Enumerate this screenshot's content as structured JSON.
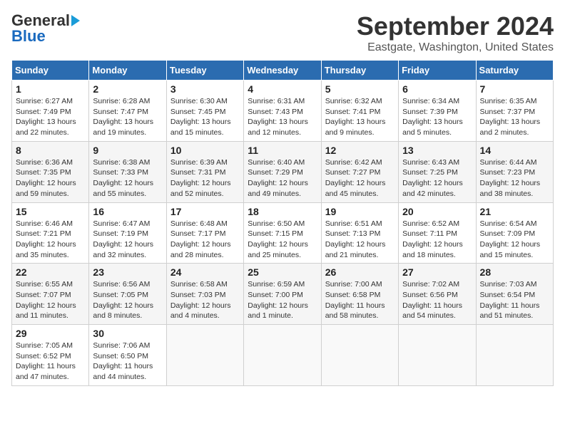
{
  "header": {
    "logo_general": "General",
    "logo_blue": "Blue",
    "title": "September 2024",
    "subtitle": "Eastgate, Washington, United States"
  },
  "calendar": {
    "columns": [
      "Sunday",
      "Monday",
      "Tuesday",
      "Wednesday",
      "Thursday",
      "Friday",
      "Saturday"
    ],
    "weeks": [
      [
        null,
        {
          "day": "2",
          "sunrise": "6:28 AM",
          "sunset": "7:47 PM",
          "daylight": "13 hours and 19 minutes."
        },
        {
          "day": "3",
          "sunrise": "6:30 AM",
          "sunset": "7:45 PM",
          "daylight": "13 hours and 15 minutes."
        },
        {
          "day": "4",
          "sunrise": "6:31 AM",
          "sunset": "7:43 PM",
          "daylight": "13 hours and 12 minutes."
        },
        {
          "day": "5",
          "sunrise": "6:32 AM",
          "sunset": "7:41 PM",
          "daylight": "13 hours and 9 minutes."
        },
        {
          "day": "6",
          "sunrise": "6:34 AM",
          "sunset": "7:39 PM",
          "daylight": "13 hours and 5 minutes."
        },
        {
          "day": "7",
          "sunrise": "6:35 AM",
          "sunset": "7:37 PM",
          "daylight": "13 hours and 2 minutes."
        }
      ],
      [
        {
          "day": "1",
          "sunrise": "6:27 AM",
          "sunset": "7:49 PM",
          "daylight": "13 hours and 22 minutes."
        },
        {
          "day": "9",
          "sunrise": "6:38 AM",
          "sunset": "7:33 PM",
          "daylight": "12 hours and 55 minutes."
        },
        {
          "day": "10",
          "sunrise": "6:39 AM",
          "sunset": "7:31 PM",
          "daylight": "12 hours and 52 minutes."
        },
        {
          "day": "11",
          "sunrise": "6:40 AM",
          "sunset": "7:29 PM",
          "daylight": "12 hours and 49 minutes."
        },
        {
          "day": "12",
          "sunrise": "6:42 AM",
          "sunset": "7:27 PM",
          "daylight": "12 hours and 45 minutes."
        },
        {
          "day": "13",
          "sunrise": "6:43 AM",
          "sunset": "7:25 PM",
          "daylight": "12 hours and 42 minutes."
        },
        {
          "day": "14",
          "sunrise": "6:44 AM",
          "sunset": "7:23 PM",
          "daylight": "12 hours and 38 minutes."
        }
      ],
      [
        {
          "day": "8",
          "sunrise": "6:36 AM",
          "sunset": "7:35 PM",
          "daylight": "12 hours and 59 minutes."
        },
        {
          "day": "16",
          "sunrise": "6:47 AM",
          "sunset": "7:19 PM",
          "daylight": "12 hours and 32 minutes."
        },
        {
          "day": "17",
          "sunrise": "6:48 AM",
          "sunset": "7:17 PM",
          "daylight": "12 hours and 28 minutes."
        },
        {
          "day": "18",
          "sunrise": "6:50 AM",
          "sunset": "7:15 PM",
          "daylight": "12 hours and 25 minutes."
        },
        {
          "day": "19",
          "sunrise": "6:51 AM",
          "sunset": "7:13 PM",
          "daylight": "12 hours and 21 minutes."
        },
        {
          "day": "20",
          "sunrise": "6:52 AM",
          "sunset": "7:11 PM",
          "daylight": "12 hours and 18 minutes."
        },
        {
          "day": "21",
          "sunrise": "6:54 AM",
          "sunset": "7:09 PM",
          "daylight": "12 hours and 15 minutes."
        }
      ],
      [
        {
          "day": "15",
          "sunrise": "6:46 AM",
          "sunset": "7:21 PM",
          "daylight": "12 hours and 35 minutes."
        },
        {
          "day": "23",
          "sunrise": "6:56 AM",
          "sunset": "7:05 PM",
          "daylight": "12 hours and 8 minutes."
        },
        {
          "day": "24",
          "sunrise": "6:58 AM",
          "sunset": "7:03 PM",
          "daylight": "12 hours and 4 minutes."
        },
        {
          "day": "25",
          "sunrise": "6:59 AM",
          "sunset": "7:00 PM",
          "daylight": "12 hours and 1 minute."
        },
        {
          "day": "26",
          "sunrise": "7:00 AM",
          "sunset": "6:58 PM",
          "daylight": "11 hours and 58 minutes."
        },
        {
          "day": "27",
          "sunrise": "7:02 AM",
          "sunset": "6:56 PM",
          "daylight": "11 hours and 54 minutes."
        },
        {
          "day": "28",
          "sunrise": "7:03 AM",
          "sunset": "6:54 PM",
          "daylight": "11 hours and 51 minutes."
        }
      ],
      [
        {
          "day": "22",
          "sunrise": "6:55 AM",
          "sunset": "7:07 PM",
          "daylight": "12 hours and 11 minutes."
        },
        {
          "day": "30",
          "sunrise": "7:06 AM",
          "sunset": "6:50 PM",
          "daylight": "11 hours and 44 minutes."
        },
        null,
        null,
        null,
        null,
        null
      ],
      [
        {
          "day": "29",
          "sunrise": "7:05 AM",
          "sunset": "6:52 PM",
          "daylight": "11 hours and 47 minutes."
        },
        null,
        null,
        null,
        null,
        null,
        null
      ]
    ]
  }
}
